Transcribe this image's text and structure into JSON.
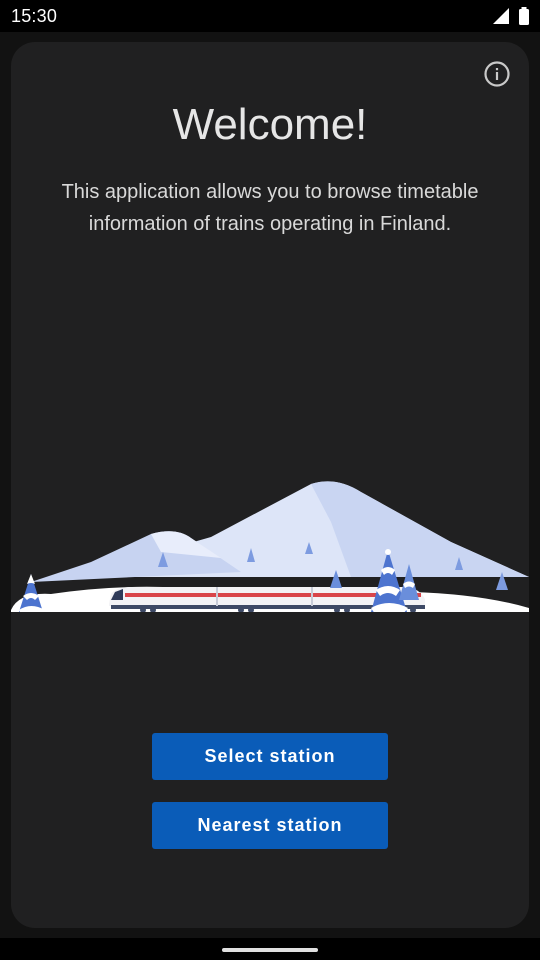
{
  "status_bar": {
    "time": "15:30",
    "icons": [
      "signal-icon",
      "battery-icon"
    ]
  },
  "welcome": {
    "title": "Welcome!",
    "description": "This application allows you to browse timetable information of trains operating in Finland.",
    "info_icon": "info-icon"
  },
  "illustration": {
    "subject": "winter landscape with passenger train",
    "colors": {
      "snow": "#ffffff",
      "mountain_shade": "#c7d3f1",
      "tree": "#5d84d6",
      "train_stripe": "#d9454a"
    }
  },
  "actions": {
    "select_station_label": "Select station",
    "nearest_station_label": "Nearest station"
  },
  "colors": {
    "background": "#121212",
    "card": "#202021",
    "primary_button": "#0a5cb8",
    "text": "#e6e6e6"
  }
}
